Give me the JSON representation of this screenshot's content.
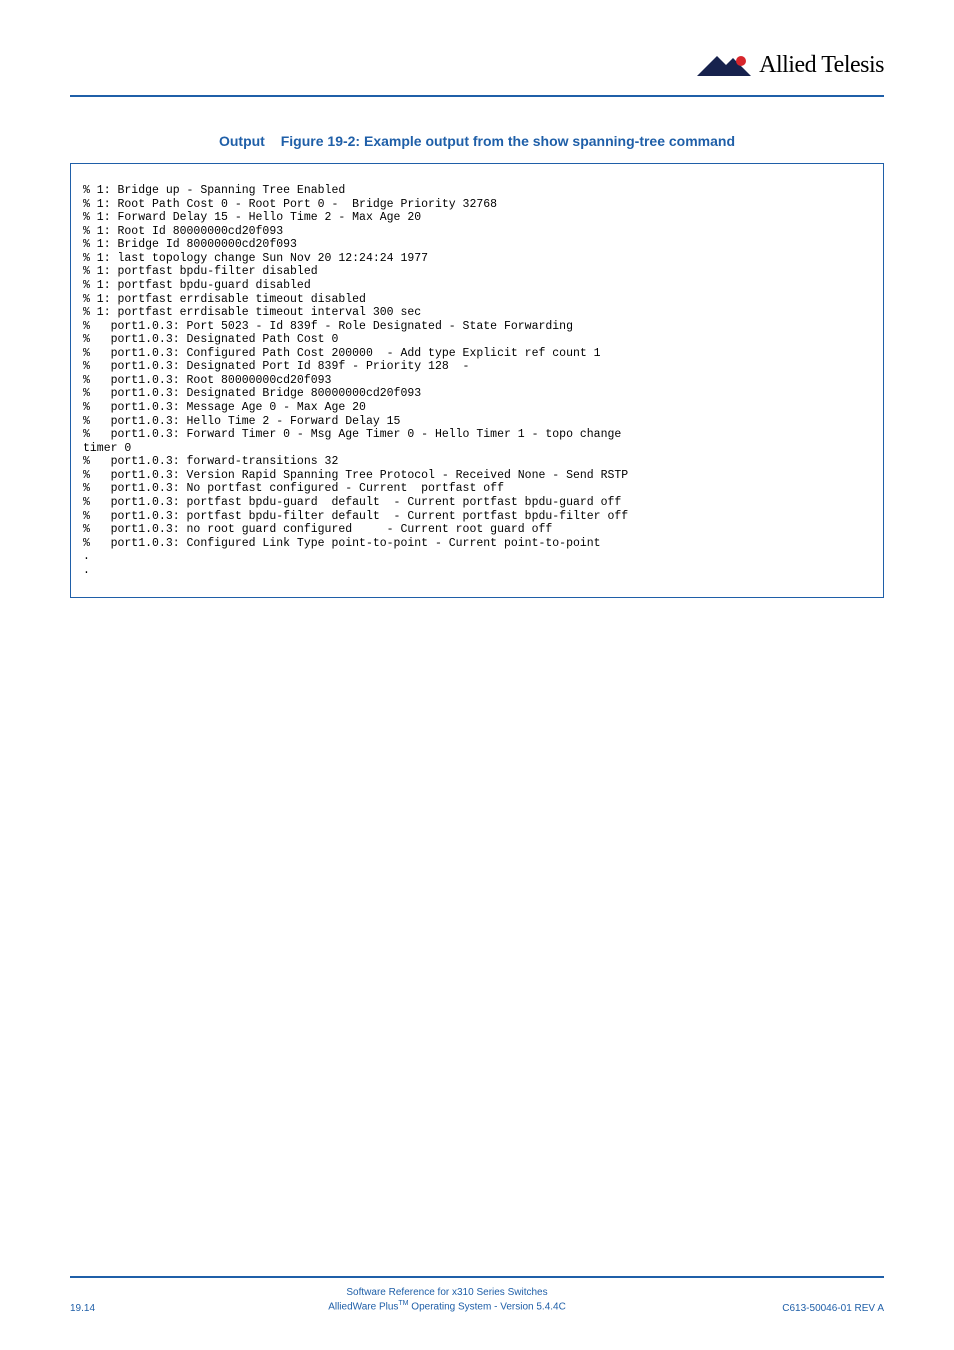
{
  "header": {
    "brand": "Allied Telesis"
  },
  "caption": {
    "label": "Output",
    "text": "Figure 19-2: Example output from the show spanning-tree command"
  },
  "output": "% 1: Bridge up - Spanning Tree Enabled\n% 1: Root Path Cost 0 - Root Port 0 -  Bridge Priority 32768\n% 1: Forward Delay 15 - Hello Time 2 - Max Age 20\n% 1: Root Id 80000000cd20f093\n% 1: Bridge Id 80000000cd20f093\n% 1: last topology change Sun Nov 20 12:24:24 1977\n% 1: portfast bpdu-filter disabled\n% 1: portfast bpdu-guard disabled\n% 1: portfast errdisable timeout disabled\n% 1: portfast errdisable timeout interval 300 sec\n%   port1.0.3: Port 5023 - Id 839f - Role Designated - State Forwarding\n%   port1.0.3: Designated Path Cost 0\n%   port1.0.3: Configured Path Cost 200000  - Add type Explicit ref count 1\n%   port1.0.3: Designated Port Id 839f - Priority 128  -\n%   port1.0.3: Root 80000000cd20f093\n%   port1.0.3: Designated Bridge 80000000cd20f093\n%   port1.0.3: Message Age 0 - Max Age 20\n%   port1.0.3: Hello Time 2 - Forward Delay 15\n%   port1.0.3: Forward Timer 0 - Msg Age Timer 0 - Hello Timer 1 - topo change \ntimer 0\n%   port1.0.3: forward-transitions 32\n%   port1.0.3: Version Rapid Spanning Tree Protocol - Received None - Send RSTP\n%   port1.0.3: No portfast configured - Current  portfast off\n%   port1.0.3: portfast bpdu-guard  default  - Current portfast bpdu-guard off\n%   port1.0.3: portfast bpdu-filter default  - Current portfast bpdu-filter off\n%   port1.0.3: no root guard configured     - Current root guard off\n%   port1.0.3: Configured Link Type point-to-point - Current point-to-point\n.\n.",
  "footer": {
    "page": "19.14",
    "line1": "Software Reference for x310 Series Switches",
    "line2_pre": "AlliedWare Plus",
    "line2_tm": "TM",
    "line2_post": " Operating System  - Version 5.4.4C",
    "rev": "C613-50046-01 REV A"
  }
}
